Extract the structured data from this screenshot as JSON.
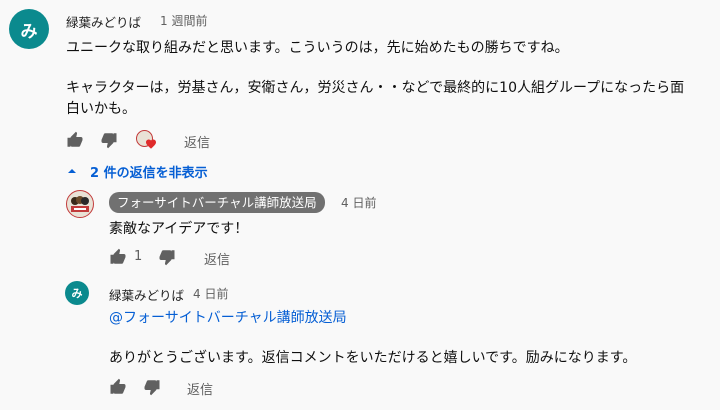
{
  "comment": {
    "avatar_letter": "み",
    "author": "緑葉みどりば",
    "time": "1 週間前",
    "text_line1": "ユニークな取り組みだと思います。こういうのは，先に始めたもの勝ちですね。",
    "text_line2": "キャラクターは，労基さん，安衛さん，労災さん・・などで最終的に10人組グループになったら面",
    "text_line3": "白いかも。",
    "reply_label": "返信",
    "heart_color": "#e02b2b"
  },
  "replies_toggle": {
    "label": "2 件の返信を非表示"
  },
  "reply1": {
    "author": "フォーサイトバーチャル講師放送局",
    "time": "4 日前",
    "text": "素敵なアイデアです！",
    "like_count": "1",
    "reply_label": "返信"
  },
  "reply2": {
    "avatar_letter": "み",
    "author": "緑葉みどりば",
    "time": "4 日前",
    "mention": "@フォーサイトバーチャル講師放送局",
    "text": "ありがとうございます。返信コメントをいただけると嬉しいです。励みになります。",
    "reply_label": "返信"
  },
  "colors": {
    "background": "#f9f9f9",
    "avatar_teal": "#0b8a8e",
    "link_blue": "#065fd4",
    "badge_gray": "#717171"
  }
}
